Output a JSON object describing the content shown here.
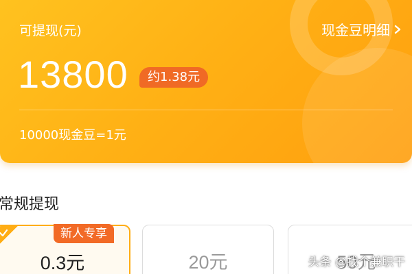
{
  "colors": {
    "card_gradient_start": "#ffc21f",
    "card_gradient_end": "#ff9f0e",
    "badge": "#f06a25",
    "selected_border": "#ffad14",
    "muted_text": "#9a9a9a"
  },
  "balance": {
    "label": "可提现(元)",
    "amount": "13800",
    "approx": "约1.38元",
    "detail_link": "现金豆明细",
    "rate": "10000现金豆=1元"
  },
  "withdraw": {
    "section_title": "常规提现",
    "options": [
      {
        "value": "0.3元",
        "tag": "新人专享",
        "selected": true
      },
      {
        "value": "20元",
        "selected": false
      },
      {
        "value": "50元",
        "selected": false
      }
    ]
  },
  "watermark": "头条 @找个兼职干",
  "icons": [
    "chevron-right-icon",
    "check-icon"
  ]
}
